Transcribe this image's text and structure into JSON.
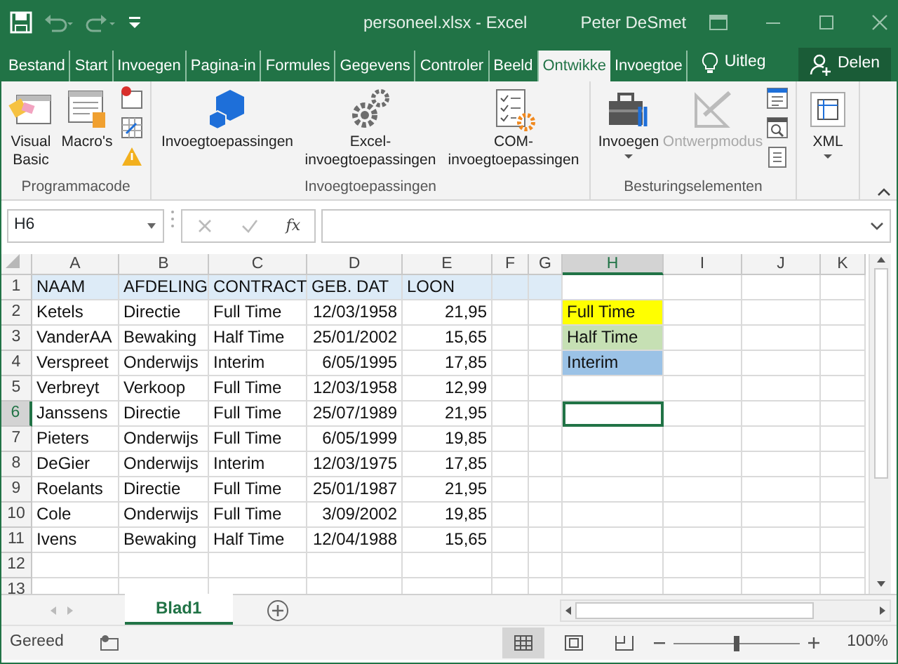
{
  "window": {
    "title": "personeel.xlsx - Excel",
    "user": "Peter DeSmet"
  },
  "tabs": [
    {
      "label": "Bestand",
      "selected": false
    },
    {
      "label": "Start",
      "selected": false
    },
    {
      "label": "Invoegen",
      "selected": false
    },
    {
      "label": "Pagina-in",
      "selected": false
    },
    {
      "label": "Formules",
      "selected": false
    },
    {
      "label": "Gegevens",
      "selected": false
    },
    {
      "label": "Controler",
      "selected": false
    },
    {
      "label": "Beeld",
      "selected": false
    },
    {
      "label": "Ontwikke",
      "selected": true
    },
    {
      "label": "Invoegtoe",
      "selected": false
    }
  ],
  "tell_me": "Uitleg",
  "share": "Delen",
  "ribbon": {
    "groups": [
      {
        "label": "Programmacode",
        "buttons": [
          {
            "label": "Visual Basic",
            "dropdown": false,
            "disabled": false
          },
          {
            "label": "Macro's",
            "dropdown": false,
            "disabled": false
          }
        ]
      },
      {
        "label": "Invoegtoepassingen",
        "buttons": [
          {
            "label": "Invoegtoepassingen",
            "dropdown": false,
            "disabled": false
          },
          {
            "label": "Excel-invoegtoepassingen",
            "dropdown": false,
            "disabled": false
          },
          {
            "label": "COM-invoegtoepassingen",
            "dropdown": false,
            "disabled": false
          }
        ]
      },
      {
        "label": "Besturingselementen",
        "buttons": [
          {
            "label": "Invoegen",
            "dropdown": true,
            "disabled": false
          },
          {
            "label": "Ontwerpmodus",
            "dropdown": false,
            "disabled": true
          }
        ]
      },
      {
        "buttons": [
          {
            "label": "XML",
            "dropdown": true,
            "disabled": false
          }
        ]
      }
    ]
  },
  "formula_bar": {
    "name_box": "H6",
    "function_label": "fx"
  },
  "sheet": {
    "columns": [
      {
        "label": "A",
        "selected": false
      },
      {
        "label": "B",
        "selected": false
      },
      {
        "label": "C",
        "selected": false
      },
      {
        "label": "D",
        "selected": false
      },
      {
        "label": "E",
        "selected": false
      },
      {
        "label": "F",
        "selected": false
      },
      {
        "label": "G",
        "selected": false
      },
      {
        "label": "H",
        "selected": true
      },
      {
        "label": "I",
        "selected": false
      },
      {
        "label": "J",
        "selected": false
      },
      {
        "label": "K",
        "selected": false
      }
    ],
    "rows": [
      {
        "label": "1",
        "selected": false
      },
      {
        "label": "2",
        "selected": false
      },
      {
        "label": "3",
        "selected": false
      },
      {
        "label": "4",
        "selected": false
      },
      {
        "label": "5",
        "selected": false
      },
      {
        "label": "6",
        "selected": true
      },
      {
        "label": "7",
        "selected": false
      },
      {
        "label": "8",
        "selected": false
      },
      {
        "label": "9",
        "selected": false
      },
      {
        "label": "10",
        "selected": false
      },
      {
        "label": "11",
        "selected": false
      },
      {
        "label": "12",
        "selected": false
      },
      {
        "label": "13",
        "selected": false
      }
    ],
    "table": {
      "header": [
        "NAAM",
        "AFDELING",
        "CONTRACT",
        "GEB. DAT",
        "LOON"
      ],
      "rows": [
        [
          "Ketels",
          "Directie",
          "Full Time",
          "12/03/1958",
          "21,95"
        ],
        [
          "VanderAA",
          "Bewaking",
          "Half Time",
          "25/01/2002",
          "15,65"
        ],
        [
          "Verspreet",
          "Onderwijs",
          "Interim",
          "6/05/1995",
          "17,85"
        ],
        [
          "Verbreyt",
          "Verkoop",
          "Full Time",
          "12/03/1958",
          "12,99"
        ],
        [
          "Janssens",
          "Directie",
          "Full Time",
          "25/07/1989",
          "21,95"
        ],
        [
          "Pieters",
          "Onderwijs",
          "Full Time",
          "6/05/1999",
          "19,85"
        ],
        [
          "DeGier",
          "Onderwijs",
          "Interim",
          "12/03/1975",
          "17,85"
        ],
        [
          "Roelants",
          "Directie",
          "Full Time",
          "25/01/1987",
          "21,95"
        ],
        [
          "Cole",
          "Onderwijs",
          "Full Time",
          "3/09/2002",
          "19,85"
        ],
        [
          "Ivens",
          "Bewaking",
          "Half Time",
          "12/04/1988",
          "15,65"
        ]
      ]
    },
    "legend": [
      {
        "label": "Full Time",
        "color": "#ffff00"
      },
      {
        "label": "Half Time",
        "color": "#c6e0b4"
      },
      {
        "label": "Interim",
        "color": "#9bc2e6"
      }
    ]
  },
  "sheet_tabs": [
    {
      "label": "Blad1",
      "selected": true
    }
  ],
  "status_bar": {
    "text": "Gereed",
    "zoom": "100%",
    "zoom_slider": {
      "level": 0.5
    }
  }
}
